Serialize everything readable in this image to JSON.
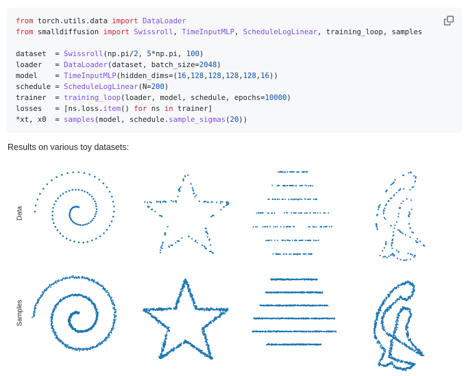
{
  "code": {
    "lines": [
      [
        [
          "kw",
          "from"
        ],
        [
          "t",
          " torch.utils.data "
        ],
        [
          "kw",
          "import"
        ],
        [
          "t",
          " "
        ],
        [
          "fn",
          "DataLoader"
        ]
      ],
      [
        [
          "kw",
          "from"
        ],
        [
          "t",
          " smalldiffusion "
        ],
        [
          "kw",
          "import"
        ],
        [
          "t",
          " "
        ],
        [
          "fn",
          "Swissroll"
        ],
        [
          "t",
          ", "
        ],
        [
          "fn",
          "TimeInputMLP"
        ],
        [
          "t",
          ", "
        ],
        [
          "fn",
          "ScheduleLogLinear"
        ],
        [
          "t",
          ", training_loop, samples"
        ]
      ],
      [],
      [
        [
          "t",
          "dataset  = "
        ],
        [
          "fn",
          "Swissroll"
        ],
        [
          "t",
          "(np.pi/"
        ],
        [
          "num",
          "2"
        ],
        [
          "t",
          ", "
        ],
        [
          "num",
          "5"
        ],
        [
          "t",
          "*np.pi, "
        ],
        [
          "num",
          "100"
        ],
        [
          "t",
          ")"
        ]
      ],
      [
        [
          "t",
          "loader   = "
        ],
        [
          "fn",
          "DataLoader"
        ],
        [
          "t",
          "(dataset, batch_size="
        ],
        [
          "num",
          "2048"
        ],
        [
          "t",
          ")"
        ]
      ],
      [
        [
          "t",
          "model    = "
        ],
        [
          "fn",
          "TimeInputMLP"
        ],
        [
          "t",
          "(hidden_dims=("
        ],
        [
          "num",
          "16"
        ],
        [
          "t",
          ","
        ],
        [
          "num",
          "128"
        ],
        [
          "t",
          ","
        ],
        [
          "num",
          "128"
        ],
        [
          "t",
          ","
        ],
        [
          "num",
          "128"
        ],
        [
          "t",
          ","
        ],
        [
          "num",
          "128"
        ],
        [
          "t",
          ","
        ],
        [
          "num",
          "16"
        ],
        [
          "t",
          "))"
        ]
      ],
      [
        [
          "t",
          "schedule = "
        ],
        [
          "fn",
          "ScheduleLogLinear"
        ],
        [
          "t",
          "(N="
        ],
        [
          "num",
          "200"
        ],
        [
          "t",
          ")"
        ]
      ],
      [
        [
          "t",
          "trainer  = "
        ],
        [
          "fn",
          "training_loop"
        ],
        [
          "t",
          "(loader, model, schedule, epochs="
        ],
        [
          "num",
          "10000"
        ],
        [
          "t",
          ")"
        ]
      ],
      [
        [
          "t",
          "losses   = [ns.loss."
        ],
        [
          "fn",
          "item"
        ],
        [
          "t",
          "() "
        ],
        [
          "kw",
          "for"
        ],
        [
          "t",
          " ns "
        ],
        [
          "kw",
          "in"
        ],
        [
          "t",
          " trainer]"
        ]
      ],
      [
        [
          "t",
          "*xt, x0  = "
        ],
        [
          "fn",
          "samples"
        ],
        [
          "t",
          "(model, schedule."
        ],
        [
          "fn",
          "sample_sigmas"
        ],
        [
          "t",
          "("
        ],
        [
          "num",
          "20"
        ],
        [
          "t",
          "))"
        ]
      ]
    ],
    "copy_icon": "copy-icon"
  },
  "caption": "Results on various toy datasets:",
  "rows": [
    {
      "label": "Data"
    },
    {
      "label": "Samples"
    }
  ],
  "colors": {
    "point": "#1f77b4"
  },
  "datasets": [
    "swissroll",
    "star",
    "lines",
    "dinosaur"
  ]
}
